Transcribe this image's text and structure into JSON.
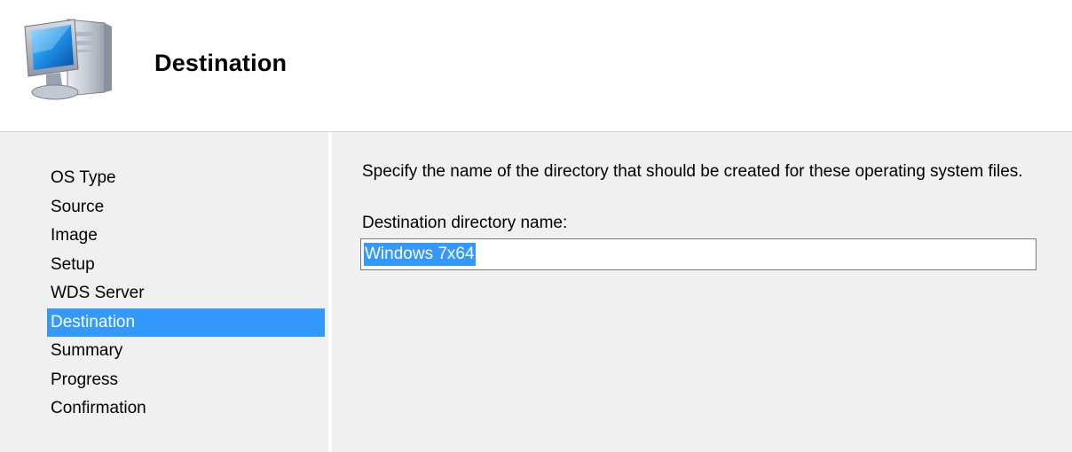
{
  "header": {
    "title": "Destination",
    "icon": "computer-icon"
  },
  "nav": {
    "items": [
      {
        "label": "OS Type",
        "selected": false
      },
      {
        "label": "Source",
        "selected": false
      },
      {
        "label": "Image",
        "selected": false
      },
      {
        "label": "Setup",
        "selected": false
      },
      {
        "label": "WDS Server",
        "selected": false
      },
      {
        "label": "Destination",
        "selected": true
      },
      {
        "label": "Summary",
        "selected": false
      },
      {
        "label": "Progress",
        "selected": false
      },
      {
        "label": "Confirmation",
        "selected": false
      }
    ]
  },
  "content": {
    "instruction": "Specify the name of the directory that should be created for these operating system files.",
    "field_label": "Destination directory name:",
    "field_value": "Windows 7x64"
  },
  "colors": {
    "selection": "#3399ff",
    "panel_background": "#f0f0f0"
  }
}
